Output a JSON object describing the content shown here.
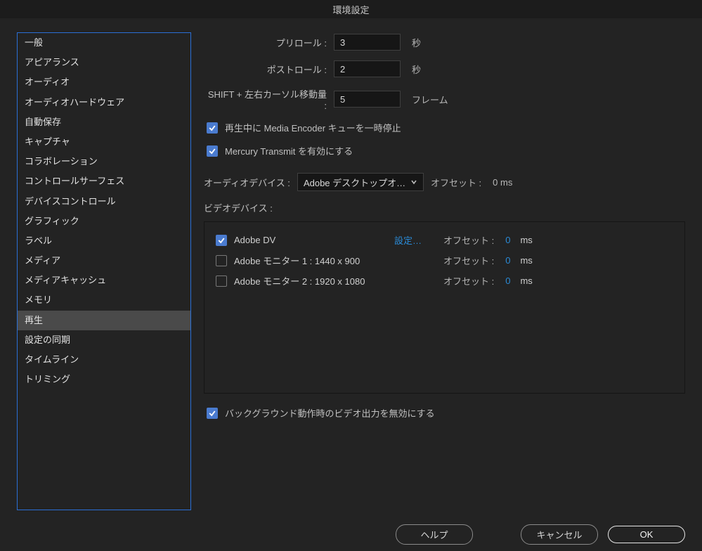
{
  "window": {
    "title": "環境設定"
  },
  "sidebar": {
    "items": [
      "一般",
      "アピアランス",
      "オーディオ",
      "オーディオハードウェア",
      "自動保存",
      "キャプチャ",
      "コラボレーション",
      "コントロールサーフェス",
      "デバイスコントロール",
      "グラフィック",
      "ラベル",
      "メディア",
      "メディアキャッシュ",
      "メモリ",
      "再生",
      "設定の同期",
      "タイムライン",
      "トリミング"
    ],
    "activeIndex": 14
  },
  "form": {
    "preroll": {
      "label": "プリロール :",
      "value": "3",
      "unit": "秒"
    },
    "postroll": {
      "label": "ポストロール :",
      "value": "2",
      "unit": "秒"
    },
    "shiftCursor": {
      "label": "SHIFT + 左右カーソル移動量 :",
      "value": "5",
      "unit": "フレーム"
    },
    "pauseEncoder": {
      "checked": true,
      "label": "再生中に Media Encoder キューを一時停止"
    },
    "mercuryTransmit": {
      "checked": true,
      "label": "Mercury Transmit を有効にする"
    },
    "audioDevice": {
      "label": "オーディオデバイス :",
      "value": "Adobe デスクトップオ…",
      "offsetLabel": "オフセット :",
      "offsetValue": "0 ms"
    },
    "videoDevice": {
      "label": "ビデオデバイス :"
    },
    "videoItems": [
      {
        "checked": true,
        "name": "Adobe DV",
        "link": "設定…",
        "offsetLabel": "オフセット :",
        "offsetValue": "0",
        "offsetUnit": "ms"
      },
      {
        "checked": false,
        "name": "Adobe モニター 1 : 1440 x 900",
        "link": "",
        "offsetLabel": "オフセット :",
        "offsetValue": "0",
        "offsetUnit": "ms"
      },
      {
        "checked": false,
        "name": "Adobe モニター 2 : 1920 x 1080",
        "link": "",
        "offsetLabel": "オフセット :",
        "offsetValue": "0",
        "offsetUnit": "ms"
      }
    ],
    "disableBgOutput": {
      "checked": true,
      "label": "バックグラウンド動作時のビデオ出力を無効にする"
    }
  },
  "footer": {
    "help": "ヘルプ",
    "cancel": "キャンセル",
    "ok": "OK"
  }
}
